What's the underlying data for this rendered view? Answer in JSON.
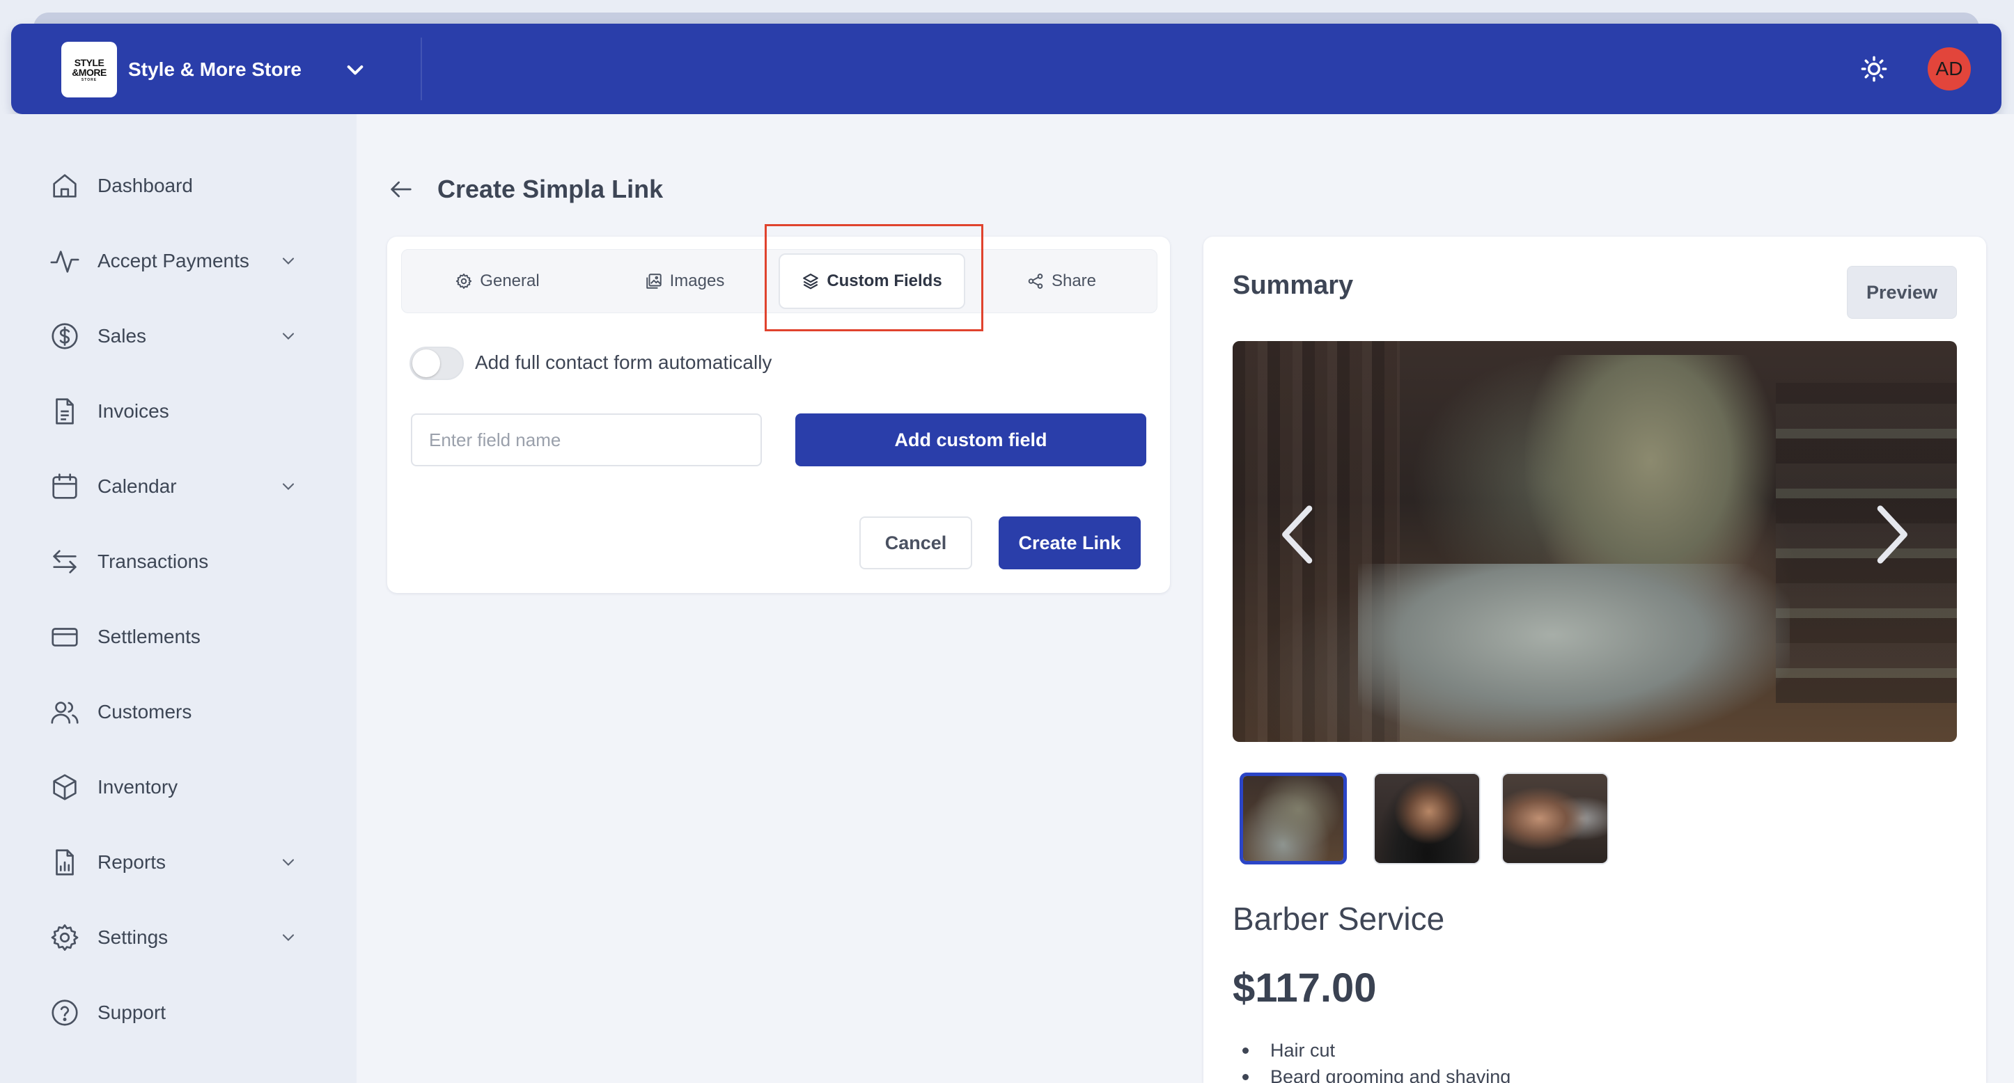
{
  "brand": {
    "logo_line1": "STYLE",
    "logo_line2": "&MORE",
    "logo_line3": "STORE",
    "store_name": "Style & More Store"
  },
  "header": {
    "avatar_initials": "AD",
    "accent_color": "#2a3eaa",
    "avatar_color": "#e2453b"
  },
  "sidebar": {
    "items": [
      {
        "label": "Dashboard",
        "icon": "home-icon",
        "has_submenu": false
      },
      {
        "label": "Accept Payments",
        "icon": "activity-icon",
        "has_submenu": true
      },
      {
        "label": "Sales",
        "icon": "dollar-circle-icon",
        "has_submenu": true
      },
      {
        "label": "Invoices",
        "icon": "file-text-icon",
        "has_submenu": false
      },
      {
        "label": "Calendar",
        "icon": "calendar-icon",
        "has_submenu": true
      },
      {
        "label": "Transactions",
        "icon": "arrows-left-right-icon",
        "has_submenu": false
      },
      {
        "label": "Settlements",
        "icon": "credit-card-icon",
        "has_submenu": false
      },
      {
        "label": "Customers",
        "icon": "users-icon",
        "has_submenu": false
      },
      {
        "label": "Inventory",
        "icon": "box-icon",
        "has_submenu": false
      },
      {
        "label": "Reports",
        "icon": "report-icon",
        "has_submenu": true
      },
      {
        "label": "Settings",
        "icon": "gear-icon",
        "has_submenu": true
      },
      {
        "label": "Support",
        "icon": "help-circle-icon",
        "has_submenu": false
      }
    ]
  },
  "page": {
    "title": "Create Simpla Link"
  },
  "tabs": [
    {
      "label": "General",
      "icon": "gear-icon",
      "active": false
    },
    {
      "label": "Images",
      "icon": "images-icon",
      "active": false
    },
    {
      "label": "Custom Fields",
      "icon": "layers-icon",
      "active": true
    },
    {
      "label": "Share",
      "icon": "share-icon",
      "active": false
    }
  ],
  "form": {
    "toggle_label": "Add full contact form automatically",
    "toggle_on": false,
    "field_placeholder": "Enter field name",
    "field_value": "",
    "add_button": "Add custom field",
    "cancel_button": "Cancel",
    "create_button": "Create Link"
  },
  "summary": {
    "title": "Summary",
    "preview_button": "Preview",
    "thumbnail_count": 3,
    "selected_thumbnail": 1,
    "product_name": "Barber Service",
    "price": "$117.00",
    "features": [
      "Hair cut",
      "Beard grooming and shaving"
    ]
  }
}
